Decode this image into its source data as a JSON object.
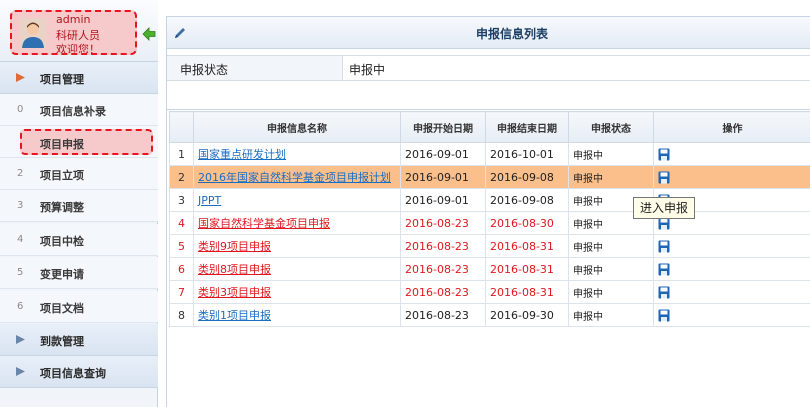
{
  "user": {
    "name": "admin",
    "role": "科研人员",
    "welcome": "欢迎您！"
  },
  "sidebar": {
    "groups": [
      {
        "label": "项目管理"
      },
      {
        "label": "到款管理"
      },
      {
        "label": "项目信息查询"
      }
    ],
    "items": [
      {
        "num": "0",
        "label": "项目信息补录"
      },
      {
        "num": "",
        "label": "项目申报"
      },
      {
        "num": "2",
        "label": "项目立项"
      },
      {
        "num": "3",
        "label": "预算调整"
      },
      {
        "num": "4",
        "label": "项目中检"
      },
      {
        "num": "5",
        "label": "变更申请"
      },
      {
        "num": "6",
        "label": "项目文档"
      }
    ]
  },
  "panel": {
    "title": "申报信息列表"
  },
  "filter": {
    "label": "申报状态",
    "value": "申报中"
  },
  "table": {
    "headers": [
      "",
      "申报信息名称",
      "申报开始日期",
      "申报结束日期",
      "申报状态",
      "操作"
    ],
    "rows": [
      {
        "idx": "1",
        "name": "国家重点研发计划",
        "start": "2016-09-01",
        "end": "2016-10-01",
        "status": "申报中"
      },
      {
        "idx": "2",
        "name": "2016年国家自然科学基金项目申报计划",
        "start": "2016-09-01",
        "end": "2016-09-08",
        "status": "申报中"
      },
      {
        "idx": "3",
        "name": "JPPT",
        "start": "2016-09-01",
        "end": "2016-09-08",
        "status": "申报中"
      },
      {
        "idx": "4",
        "name": "国家自然科学基金项目申报",
        "start": "2016-08-23",
        "end": "2016-08-30",
        "status": "申报中"
      },
      {
        "idx": "5",
        "name": "类别9项目申报",
        "start": "2016-08-23",
        "end": "2016-08-31",
        "status": "申报中"
      },
      {
        "idx": "6",
        "name": "类别8项目申报",
        "start": "2016-08-23",
        "end": "2016-08-31",
        "status": "申报中"
      },
      {
        "idx": "7",
        "name": "类别3项目申报",
        "start": "2016-08-23",
        "end": "2016-08-31",
        "status": "申报中"
      },
      {
        "idx": "8",
        "name": "类别1项目申报",
        "start": "2016-08-23",
        "end": "2016-09-30",
        "status": "申报中"
      }
    ]
  },
  "tooltip": {
    "text": "进入申报"
  },
  "colors": {
    "highlight_row": "#fbbf8c",
    "red_text": "#e0181e",
    "link_blue": "#1b6ec2",
    "title_blue": "#1c3f66",
    "annotation_red": "#e8141f"
  },
  "icons": {
    "avatar": "user-avatar-icon",
    "collapse": "arrow-left-icon",
    "group": "arrow-right-icon",
    "edit": "pencil-icon",
    "action": "save-icon"
  }
}
